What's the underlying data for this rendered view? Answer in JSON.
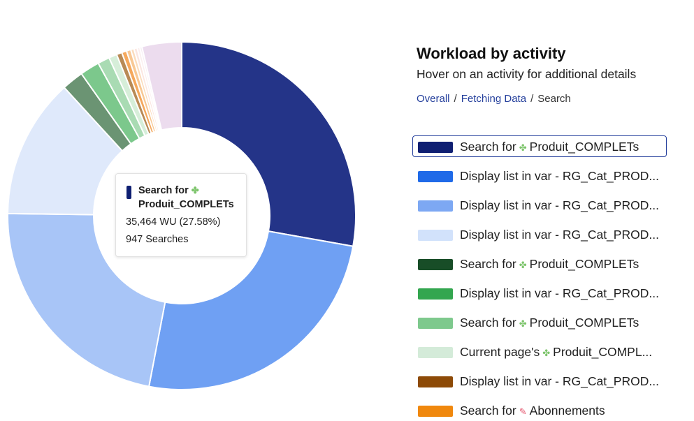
{
  "chart_data": {
    "type": "pie",
    "donut": true,
    "title": "Workload by activity",
    "subtitle": "Hover on an activity for additional details",
    "slices": [
      {
        "label": "Search for Produit_COMPLETs",
        "icon": "puzzle-icon",
        "value": 27.58,
        "color": "#243488"
      },
      {
        "label": "Display list in var - RG_Cat_PROD...",
        "value": 25.0,
        "color": "#6fa0f3"
      },
      {
        "label": "Display list in var - RG_Cat_PROD...",
        "value": 22.0,
        "color": "#a8c5f7"
      },
      {
        "label": "Display list in var - RG_Cat_PROD...",
        "value": 12.9,
        "color": "#dfe9fb"
      },
      {
        "label": "Search for Produit_COMPLETs",
        "icon": "puzzle-icon",
        "value": 2.0,
        "color": "#6b9473"
      },
      {
        "label": "Display list in var - RG_Cat_PROD...",
        "value": 1.8,
        "color": "#7cc88c"
      },
      {
        "label": "Search for Produit_COMPLETs",
        "icon": "puzzle-icon",
        "value": 1.1,
        "color": "#a9dbb3"
      },
      {
        "label": "Current page's Produit_COMPL...",
        "icon": "puzzle-icon",
        "value": 0.75,
        "color": "#d6eed9"
      },
      {
        "label": "Display list in var - RG_Cat_PROD...",
        "value": 0.5,
        "color": "#b88a55"
      },
      {
        "label": "Search for Abonnements",
        "icon": "pencil-icon",
        "value": 0.45,
        "color": "#f5a85c"
      },
      {
        "label": "",
        "value": 0.4,
        "color": "#f8c894"
      },
      {
        "label": "",
        "value": 0.3,
        "color": "#fbdcbc"
      },
      {
        "label": "",
        "value": 0.3,
        "color": "#fbe6e0"
      },
      {
        "label": "",
        "value": 0.25,
        "color": "#fbefef"
      },
      {
        "label": "",
        "value": 0.2,
        "color": "#f6ecf3"
      },
      {
        "label": "",
        "value": 3.65,
        "color": "#ecdcee"
      }
    ]
  },
  "tooltip": {
    "title_prefix": "Search for",
    "title_name": "Produit_COMPLETs",
    "line1": "35,464 WU (27.58%)",
    "line2": "947 Searches",
    "color": "#0f1f72"
  },
  "panel": {
    "title": "Workload by activity",
    "subtitle": "Hover on an activity for additional details",
    "breadcrumb": {
      "overall": "Overall",
      "fetching": "Fetching Data",
      "current": "Search"
    }
  },
  "legend": [
    {
      "prefix": "Search for",
      "icon": "puzzle-icon",
      "name": "Produit_COMPLETs",
      "color": "#0f1f72",
      "selected": true
    },
    {
      "prefix": "",
      "icon": "",
      "name": "Display list in var - RG_Cat_PROD...",
      "color": "#1f6ae8",
      "selected": false
    },
    {
      "prefix": "",
      "icon": "",
      "name": "Display list in var - RG_Cat_PROD...",
      "color": "#7da8f3",
      "selected": false
    },
    {
      "prefix": "",
      "icon": "",
      "name": "Display list in var - RG_Cat_PROD...",
      "color": "#d2e2fb",
      "selected": false
    },
    {
      "prefix": "Search for",
      "icon": "puzzle-icon",
      "name": "Produit_COMPLETs",
      "color": "#184d27",
      "selected": false
    },
    {
      "prefix": "",
      "icon": "",
      "name": "Display list in var - RG_Cat_PROD...",
      "color": "#33a64f",
      "selected": false
    },
    {
      "prefix": "Search for",
      "icon": "puzzle-icon",
      "name": "Produit_COMPLETs",
      "color": "#7ec98d",
      "selected": false
    },
    {
      "prefix": "Current page's",
      "icon": "puzzle-icon",
      "name": "Produit_COMPL...",
      "color": "#d4ebd9",
      "selected": false
    },
    {
      "prefix": "",
      "icon": "",
      "name": "Display list in var - RG_Cat_PROD...",
      "color": "#8d4a07",
      "selected": false
    },
    {
      "prefix": "Search for",
      "icon": "pencil-icon",
      "name": "Abonnements",
      "color": "#f0880d",
      "selected": false
    }
  ]
}
